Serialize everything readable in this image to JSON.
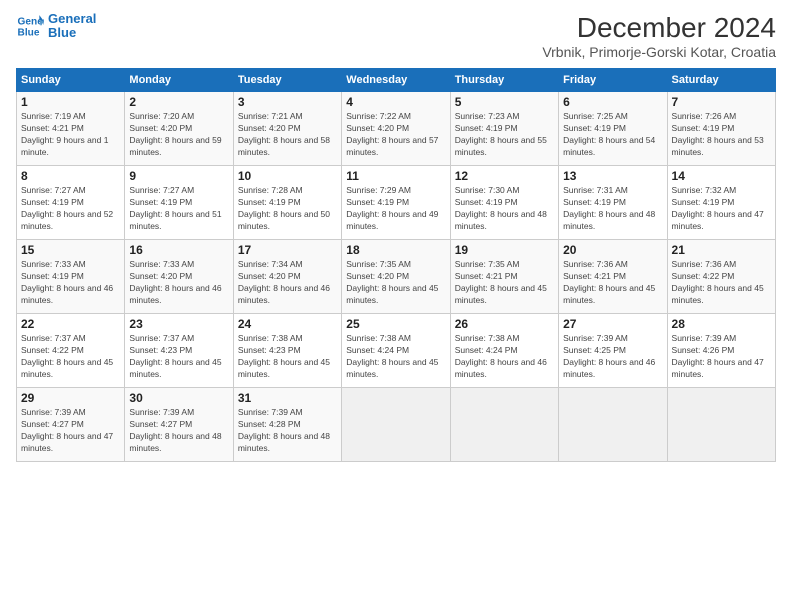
{
  "header": {
    "logo_line1": "General",
    "logo_line2": "Blue",
    "title": "December 2024",
    "subtitle": "Vrbnik, Primorje-Gorski Kotar, Croatia"
  },
  "days_of_week": [
    "Sunday",
    "Monday",
    "Tuesday",
    "Wednesday",
    "Thursday",
    "Friday",
    "Saturday"
  ],
  "weeks": [
    [
      {
        "day": "1",
        "sunrise": "7:19 AM",
        "sunset": "4:21 PM",
        "daylight": "9 hours and 1 minute."
      },
      {
        "day": "2",
        "sunrise": "7:20 AM",
        "sunset": "4:20 PM",
        "daylight": "8 hours and 59 minutes."
      },
      {
        "day": "3",
        "sunrise": "7:21 AM",
        "sunset": "4:20 PM",
        "daylight": "8 hours and 58 minutes."
      },
      {
        "day": "4",
        "sunrise": "7:22 AM",
        "sunset": "4:20 PM",
        "daylight": "8 hours and 57 minutes."
      },
      {
        "day": "5",
        "sunrise": "7:23 AM",
        "sunset": "4:19 PM",
        "daylight": "8 hours and 55 minutes."
      },
      {
        "day": "6",
        "sunrise": "7:25 AM",
        "sunset": "4:19 PM",
        "daylight": "8 hours and 54 minutes."
      },
      {
        "day": "7",
        "sunrise": "7:26 AM",
        "sunset": "4:19 PM",
        "daylight": "8 hours and 53 minutes."
      }
    ],
    [
      {
        "day": "8",
        "sunrise": "7:27 AM",
        "sunset": "4:19 PM",
        "daylight": "8 hours and 52 minutes."
      },
      {
        "day": "9",
        "sunrise": "7:27 AM",
        "sunset": "4:19 PM",
        "daylight": "8 hours and 51 minutes."
      },
      {
        "day": "10",
        "sunrise": "7:28 AM",
        "sunset": "4:19 PM",
        "daylight": "8 hours and 50 minutes."
      },
      {
        "day": "11",
        "sunrise": "7:29 AM",
        "sunset": "4:19 PM",
        "daylight": "8 hours and 49 minutes."
      },
      {
        "day": "12",
        "sunrise": "7:30 AM",
        "sunset": "4:19 PM",
        "daylight": "8 hours and 48 minutes."
      },
      {
        "day": "13",
        "sunrise": "7:31 AM",
        "sunset": "4:19 PM",
        "daylight": "8 hours and 48 minutes."
      },
      {
        "day": "14",
        "sunrise": "7:32 AM",
        "sunset": "4:19 PM",
        "daylight": "8 hours and 47 minutes."
      }
    ],
    [
      {
        "day": "15",
        "sunrise": "7:33 AM",
        "sunset": "4:19 PM",
        "daylight": "8 hours and 46 minutes."
      },
      {
        "day": "16",
        "sunrise": "7:33 AM",
        "sunset": "4:20 PM",
        "daylight": "8 hours and 46 minutes."
      },
      {
        "day": "17",
        "sunrise": "7:34 AM",
        "sunset": "4:20 PM",
        "daylight": "8 hours and 46 minutes."
      },
      {
        "day": "18",
        "sunrise": "7:35 AM",
        "sunset": "4:20 PM",
        "daylight": "8 hours and 45 minutes."
      },
      {
        "day": "19",
        "sunrise": "7:35 AM",
        "sunset": "4:21 PM",
        "daylight": "8 hours and 45 minutes."
      },
      {
        "day": "20",
        "sunrise": "7:36 AM",
        "sunset": "4:21 PM",
        "daylight": "8 hours and 45 minutes."
      },
      {
        "day": "21",
        "sunrise": "7:36 AM",
        "sunset": "4:22 PM",
        "daylight": "8 hours and 45 minutes."
      }
    ],
    [
      {
        "day": "22",
        "sunrise": "7:37 AM",
        "sunset": "4:22 PM",
        "daylight": "8 hours and 45 minutes."
      },
      {
        "day": "23",
        "sunrise": "7:37 AM",
        "sunset": "4:23 PM",
        "daylight": "8 hours and 45 minutes."
      },
      {
        "day": "24",
        "sunrise": "7:38 AM",
        "sunset": "4:23 PM",
        "daylight": "8 hours and 45 minutes."
      },
      {
        "day": "25",
        "sunrise": "7:38 AM",
        "sunset": "4:24 PM",
        "daylight": "8 hours and 45 minutes."
      },
      {
        "day": "26",
        "sunrise": "7:38 AM",
        "sunset": "4:24 PM",
        "daylight": "8 hours and 46 minutes."
      },
      {
        "day": "27",
        "sunrise": "7:39 AM",
        "sunset": "4:25 PM",
        "daylight": "8 hours and 46 minutes."
      },
      {
        "day": "28",
        "sunrise": "7:39 AM",
        "sunset": "4:26 PM",
        "daylight": "8 hours and 47 minutes."
      }
    ],
    [
      {
        "day": "29",
        "sunrise": "7:39 AM",
        "sunset": "4:27 PM",
        "daylight": "8 hours and 47 minutes."
      },
      {
        "day": "30",
        "sunrise": "7:39 AM",
        "sunset": "4:27 PM",
        "daylight": "8 hours and 48 minutes."
      },
      {
        "day": "31",
        "sunrise": "7:39 AM",
        "sunset": "4:28 PM",
        "daylight": "8 hours and 48 minutes."
      },
      null,
      null,
      null,
      null
    ]
  ],
  "labels": {
    "sunrise": "Sunrise:",
    "sunset": "Sunset:",
    "daylight": "Daylight:"
  }
}
